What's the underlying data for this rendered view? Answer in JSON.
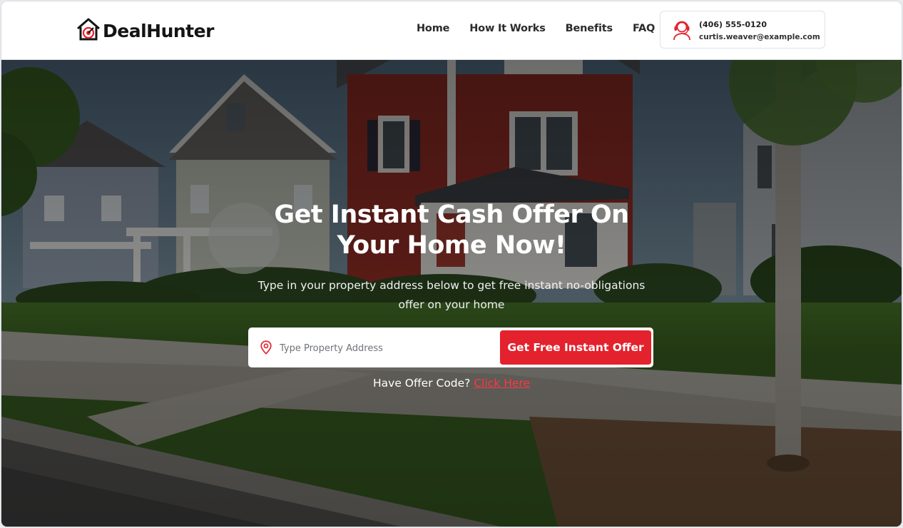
{
  "brand": {
    "name": "DealHunter",
    "accent": "#e3222d"
  },
  "nav": {
    "items": [
      "Home",
      "How It Works",
      "Benefits",
      "FAQ"
    ]
  },
  "contact": {
    "phone": "(406) 555-0120",
    "email": "curtis.weaver@example.com",
    "icon": "support-agent-icon"
  },
  "hero": {
    "title_line1": "Get Instant Cash Offer On",
    "title_line2": "Your Home Now!",
    "subtitle_line1": "Type in your property address below to get free instant no-obligations",
    "subtitle_line2": "offer on your home",
    "background": "suburban-houses-photo"
  },
  "search": {
    "placeholder": "Type Property Address",
    "value": "",
    "icon": "location-pin-icon",
    "button_label": "Get Free Instant Offer"
  },
  "offer_code": {
    "prompt": "Have Offer Code?",
    "link_label": "Click Here"
  }
}
